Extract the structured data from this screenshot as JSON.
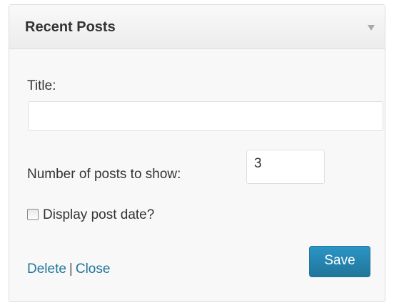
{
  "widget": {
    "title": "Recent Posts",
    "fields": {
      "title_label": "Title:",
      "title_value": "",
      "number_label": "Number of posts to show:",
      "number_value": "3",
      "show_date_label": "Display post date?",
      "show_date_checked": false
    },
    "actions": {
      "delete_label": "Delete",
      "separator": "|",
      "close_label": "Close",
      "save_label": "Save"
    }
  },
  "icons": {
    "toggle": "triangle-down-icon"
  },
  "colors": {
    "link": "#21759b",
    "button": "#21759b"
  }
}
